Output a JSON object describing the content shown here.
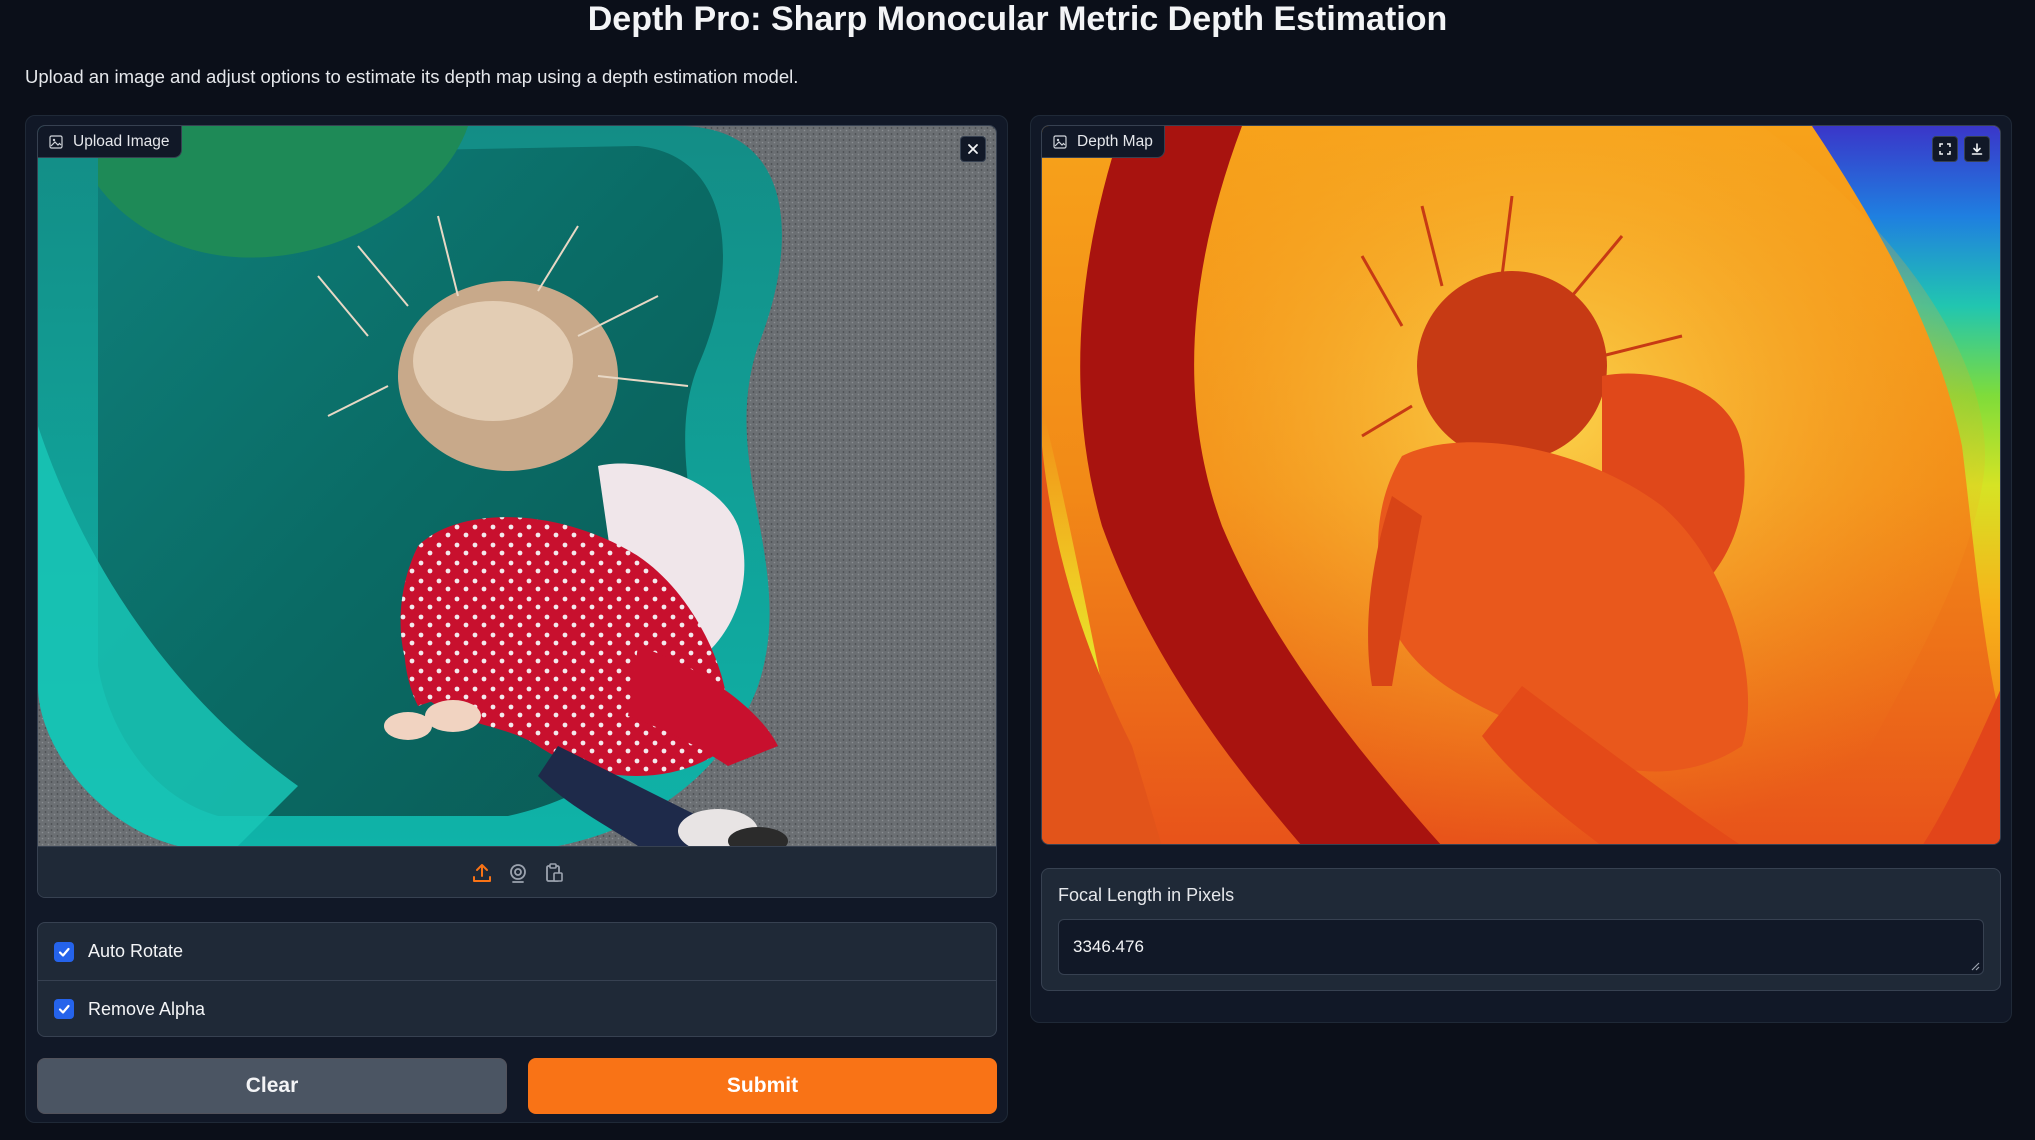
{
  "header": {
    "title": "Depth Pro: Sharp Monocular Metric Depth Estimation",
    "description": "Upload an image and adjust options to estimate its depth map using a depth estimation model."
  },
  "input_panel": {
    "image_label": "Upload Image",
    "image_label_icon": "image-icon",
    "clear_image_icon": "close-icon",
    "source_icons": [
      "upload-icon",
      "webcam-icon",
      "clipboard-icon"
    ],
    "options": [
      {
        "label": "Auto Rotate",
        "checked": true
      },
      {
        "label": "Remove Alpha",
        "checked": true
      }
    ],
    "clear_button": "Clear",
    "submit_button": "Submit"
  },
  "output_panel": {
    "image_label": "Depth Map",
    "image_label_icon": "image-icon",
    "action_icons": [
      "fullscreen-icon",
      "download-icon"
    ],
    "focal_label": "Focal Length in Pixels",
    "focal_value": "3346.476"
  },
  "colors": {
    "background": "#0b0f19",
    "panel": "#111827",
    "accent": "#f97316",
    "checkbox": "#2563eb",
    "clear_button": "#4b5563"
  }
}
